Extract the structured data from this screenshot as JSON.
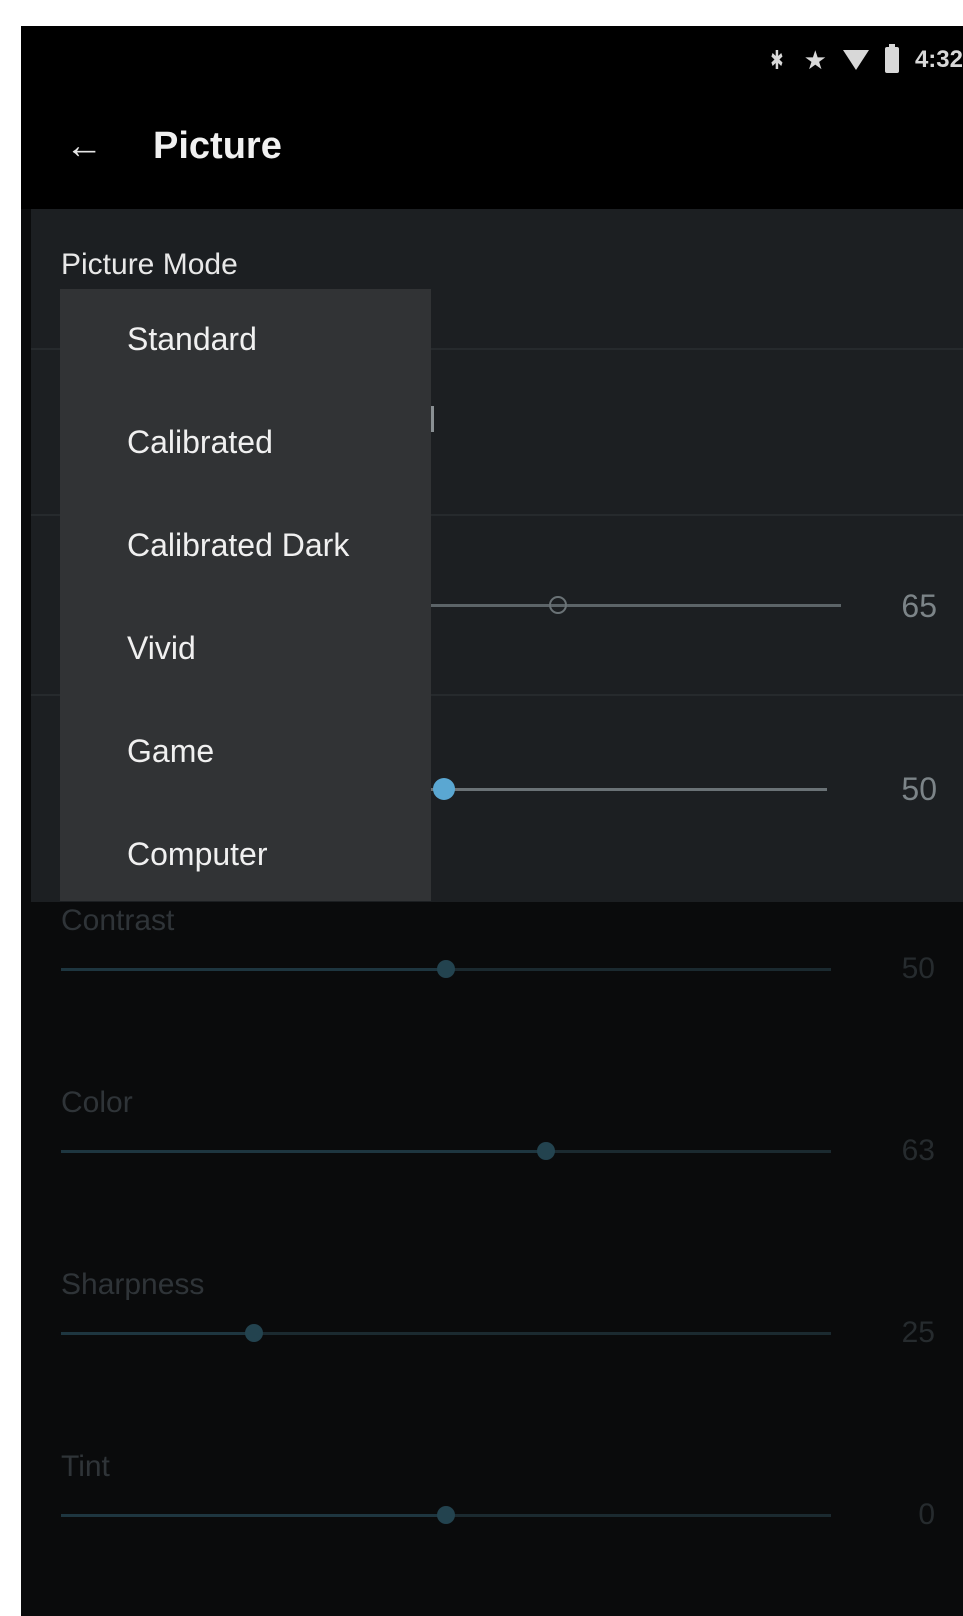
{
  "status": {
    "time": "4:32",
    "icons": [
      "bluetooth-icon",
      "star-icon",
      "wifi-icon",
      "battery-icon"
    ]
  },
  "header": {
    "title": "Picture",
    "back_icon": "arrow-left-icon"
  },
  "picture_mode": {
    "label": "Picture Mode",
    "options": [
      "Standard",
      "Calibrated",
      "Calibrated Dark",
      "Vivid",
      "Game",
      "Computer"
    ]
  },
  "partial_rows": [
    {
      "value": "65",
      "level": 0.65
    },
    {
      "value": "50",
      "level": 0.5,
      "selected": true
    }
  ],
  "settings": [
    {
      "label": "Contrast",
      "value": "50",
      "level": 0.5
    },
    {
      "label": "Color",
      "value": "63",
      "level": 0.63
    },
    {
      "label": "Sharpness",
      "value": "25",
      "level": 0.25
    },
    {
      "label": "Tint",
      "value": "0",
      "level": 0.5
    }
  ],
  "colors": {
    "accent": "#5aa7d2",
    "background": "#0a0b0c",
    "menu": "#313335"
  }
}
